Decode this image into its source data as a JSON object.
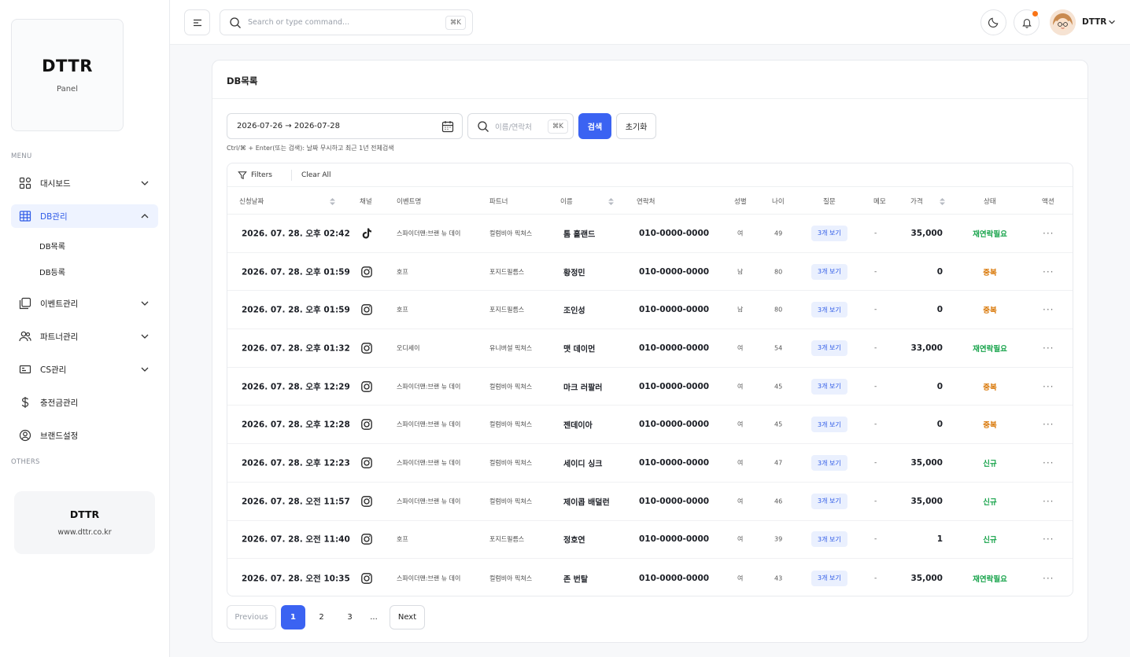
{
  "sidebar": {
    "brand_title": "DTTR",
    "brand_subtitle": "Panel",
    "menu_label": "MENU",
    "others_label": "OTHERS",
    "items": [
      {
        "label": "대시보드",
        "icon": "dashboard-icon"
      },
      {
        "label": "DB관리",
        "icon": "table-icon"
      },
      {
        "label": "이벤트관리",
        "icon": "event-icon"
      },
      {
        "label": "파트너관리",
        "icon": "users-icon"
      },
      {
        "label": "CS관리",
        "icon": "ticket-icon"
      },
      {
        "label": "충전금관리",
        "icon": "dollar-icon"
      },
      {
        "label": "브랜드설정",
        "icon": "user-circle-icon"
      }
    ],
    "subitems": [
      {
        "label": "DB목록"
      },
      {
        "label": "DB등록"
      }
    ],
    "others_card": {
      "title": "DTTR",
      "url": "www.dttr.co.kr"
    }
  },
  "topbar": {
    "search_placeholder": "Search or type command...",
    "search_shortcut": "⌘K",
    "user_name": "DTTR",
    "accent_color": "#f97316"
  },
  "main": {
    "title": "DB목록",
    "date_range": "2026-07-26 → 2026-07-28",
    "name_placeholder": "이름/연락처",
    "name_shortcut": "⌘K",
    "search_button": "검색",
    "reset_button": "초기화",
    "hint": "Ctrl/⌘ + Enter(또는 검색): 날짜 무시하고 최근 1년 전체검색",
    "filters_label": "Filters",
    "clear_all_label": "Clear All",
    "primary_color": "#3b63f2"
  },
  "table": {
    "headers": {
      "date": "신청날짜",
      "channel": "채널",
      "event": "이벤트명",
      "partner": "파트너",
      "name": "이름",
      "phone": "연락처",
      "gender": "성별",
      "age": "나이",
      "question": "질문",
      "memo": "메모",
      "price": "가격",
      "status": "상태",
      "action": "액션"
    },
    "rows": [
      {
        "date": "2026. 07. 28. 오후 02:42",
        "channel": "tiktok",
        "event": "스파이더맨:브랜 뉴 데이",
        "partner": "컬럼비아 픽쳐스",
        "name": "톰 홀랜드",
        "phone": "010-0000-0000",
        "gender": "여",
        "age": "49",
        "question": "3개 보기",
        "memo": "-",
        "price": "35,000",
        "status": "재연락필요",
        "status_color": "#16a34a"
      },
      {
        "date": "2026. 07. 28. 오후 01:59",
        "channel": "instagram",
        "event": "호프",
        "partner": "포지드필름스",
        "name": "황정민",
        "phone": "010-0000-0000",
        "gender": "남",
        "age": "80",
        "question": "3개 보기",
        "memo": "-",
        "price": "0",
        "status": "중복",
        "status_color": "#d97706"
      },
      {
        "date": "2026. 07. 28. 오후 01:59",
        "channel": "instagram",
        "event": "호프",
        "partner": "포지드필름스",
        "name": "조인성",
        "phone": "010-0000-0000",
        "gender": "남",
        "age": "80",
        "question": "3개 보기",
        "memo": "-",
        "price": "0",
        "status": "중복",
        "status_color": "#d97706"
      },
      {
        "date": "2026. 07. 28. 오후 01:32",
        "channel": "instagram",
        "event": "오디세이",
        "partner": "유니버설 픽쳐스",
        "name": "맷 데이먼",
        "phone": "010-0000-0000",
        "gender": "여",
        "age": "54",
        "question": "3개 보기",
        "memo": "-",
        "price": "33,000",
        "status": "재연락필요",
        "status_color": "#16a34a"
      },
      {
        "date": "2026. 07. 28. 오후 12:29",
        "channel": "instagram",
        "event": "스파이더맨:브랜 뉴 데이",
        "partner": "컬럼비아 픽쳐스",
        "name": "마크 러팔러",
        "phone": "010-0000-0000",
        "gender": "여",
        "age": "45",
        "question": "3개 보기",
        "memo": "-",
        "price": "0",
        "status": "중복",
        "status_color": "#d97706"
      },
      {
        "date": "2026. 07. 28. 오후 12:28",
        "channel": "instagram",
        "event": "스파이더맨:브랜 뉴 데이",
        "partner": "컬럼비아 픽쳐스",
        "name": "젠데이아",
        "phone": "010-0000-0000",
        "gender": "여",
        "age": "45",
        "question": "3개 보기",
        "memo": "-",
        "price": "0",
        "status": "중복",
        "status_color": "#d97706"
      },
      {
        "date": "2026. 07. 28. 오후 12:23",
        "channel": "instagram",
        "event": "스파이더맨:브랜 뉴 데이",
        "partner": "컬럼비아 픽쳐스",
        "name": "세이디 싱크",
        "phone": "010-0000-0000",
        "gender": "여",
        "age": "47",
        "question": "3개 보기",
        "memo": "-",
        "price": "35,000",
        "status": "신규",
        "status_color": "#16a34a"
      },
      {
        "date": "2026. 07. 28. 오전 11:57",
        "channel": "instagram",
        "event": "스파이더맨:브랜 뉴 데이",
        "partner": "컬럼비아 픽쳐스",
        "name": "제이콥 배덜런",
        "phone": "010-0000-0000",
        "gender": "여",
        "age": "46",
        "question": "3개 보기",
        "memo": "-",
        "price": "35,000",
        "status": "신규",
        "status_color": "#16a34a"
      },
      {
        "date": "2026. 07. 28. 오전 11:40",
        "channel": "instagram",
        "event": "호프",
        "partner": "포지드필름스",
        "name": "정호연",
        "phone": "010-0000-0000",
        "gender": "여",
        "age": "39",
        "question": "3개 보기",
        "memo": "-",
        "price": "1",
        "status": "신규",
        "status_color": "#16a34a"
      },
      {
        "date": "2026. 07. 28. 오전 10:35",
        "channel": "instagram",
        "event": "스파이더맨:브랜 뉴 데이",
        "partner": "컬럼비아 픽쳐스",
        "name": "존 번탈",
        "phone": "010-0000-0000",
        "gender": "여",
        "age": "43",
        "question": "3개 보기",
        "memo": "-",
        "price": "35,000",
        "status": "재연락필요",
        "status_color": "#16a34a"
      }
    ]
  },
  "pagination": {
    "previous": "Previous",
    "pages": [
      "1",
      "2",
      "3"
    ],
    "ellipsis": "...",
    "next": "Next",
    "current": "1"
  }
}
